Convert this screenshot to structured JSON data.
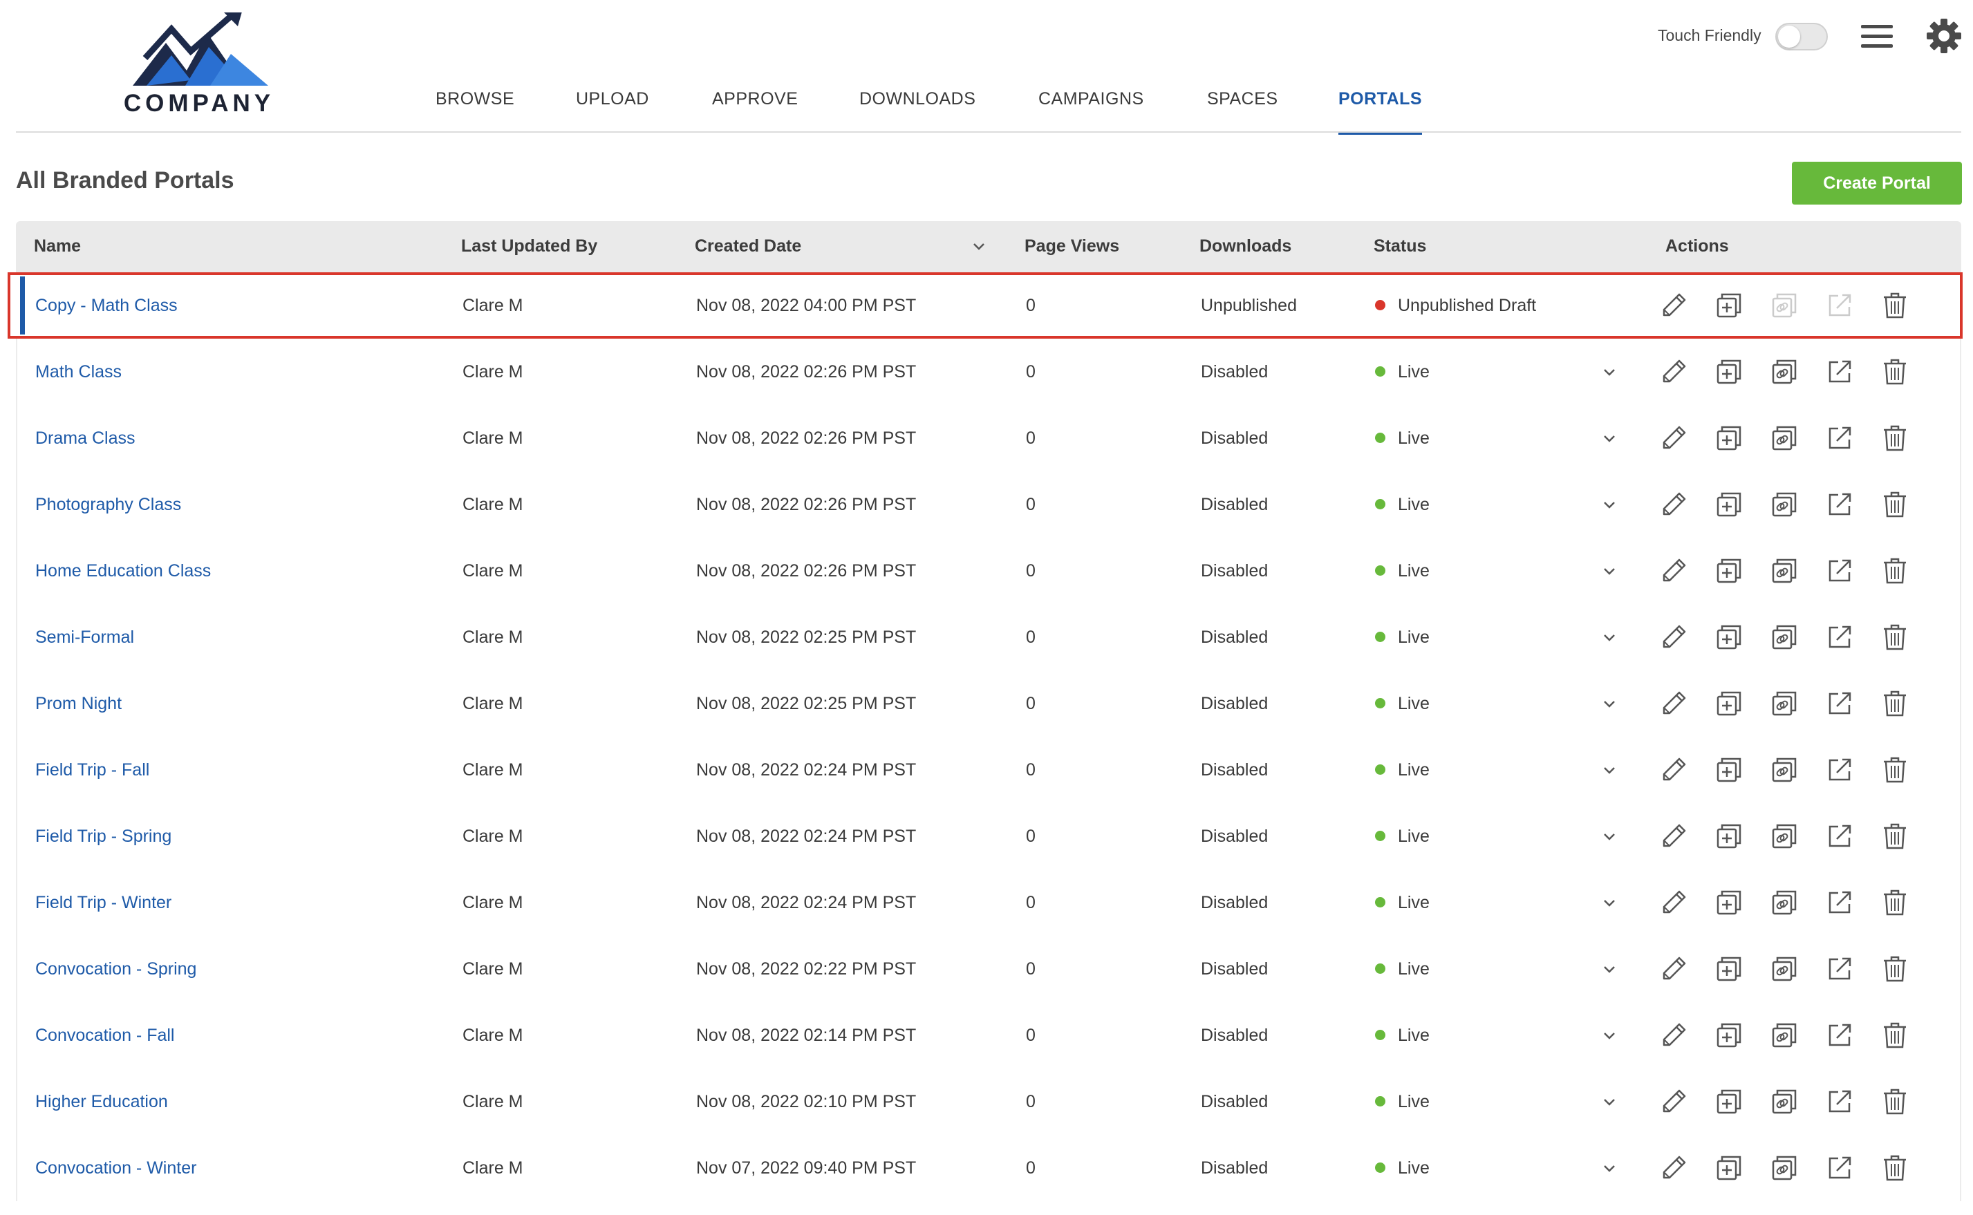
{
  "brand": {
    "logo_text": "COMPANY",
    "colors": {
      "mountain_dark": "#1d2a4a",
      "mountain_blue": "#2a6fd1"
    }
  },
  "header": {
    "nav": [
      "BROWSE",
      "UPLOAD",
      "APPROVE",
      "DOWNLOADS",
      "CAMPAIGNS",
      "SPACES",
      "PORTALS"
    ],
    "active_nav": "PORTALS",
    "touch_friendly_label": "Touch Friendly",
    "touch_friendly_on": false,
    "icons": [
      "hamburger-menu-icon",
      "gear-icon"
    ]
  },
  "page": {
    "title": "All Branded Portals",
    "create_button": "Create Portal"
  },
  "colors": {
    "accent": "#1e5aa8",
    "create_button": "#67b93b",
    "live": "#67b93b",
    "draft": "#d9362b",
    "selected_outline": "#d9362b"
  },
  "table": {
    "columns": [
      "Name",
      "Last Updated By",
      "Created Date",
      "Page Views",
      "Downloads",
      "Status",
      "Actions"
    ],
    "sorted_column": "Created Date",
    "action_icons": [
      "pencil-icon",
      "duplicate-icon",
      "copy-link-icon",
      "open-external-icon",
      "trash-icon"
    ],
    "rows": [
      {
        "name": "Copy - Math Class",
        "updated_by": "Clare M",
        "created": "Nov 08, 2022 04:00 PM PST",
        "views": "0",
        "downloads": "Unpublished",
        "status": "Unpublished Draft",
        "status_type": "draft",
        "selected": true
      },
      {
        "name": "Math Class",
        "updated_by": "Clare M",
        "created": "Nov 08, 2022 02:26 PM PST",
        "views": "0",
        "downloads": "Disabled",
        "status": "Live",
        "status_type": "live"
      },
      {
        "name": "Drama Class",
        "updated_by": "Clare M",
        "created": "Nov 08, 2022 02:26 PM PST",
        "views": "0",
        "downloads": "Disabled",
        "status": "Live",
        "status_type": "live"
      },
      {
        "name": "Photography Class",
        "updated_by": "Clare M",
        "created": "Nov 08, 2022 02:26 PM PST",
        "views": "0",
        "downloads": "Disabled",
        "status": "Live",
        "status_type": "live"
      },
      {
        "name": "Home Education Class",
        "updated_by": "Clare M",
        "created": "Nov 08, 2022 02:26 PM PST",
        "views": "0",
        "downloads": "Disabled",
        "status": "Live",
        "status_type": "live"
      },
      {
        "name": "Semi-Formal",
        "updated_by": "Clare M",
        "created": "Nov 08, 2022 02:25 PM PST",
        "views": "0",
        "downloads": "Disabled",
        "status": "Live",
        "status_type": "live"
      },
      {
        "name": "Prom Night",
        "updated_by": "Clare M",
        "created": "Nov 08, 2022 02:25 PM PST",
        "views": "0",
        "downloads": "Disabled",
        "status": "Live",
        "status_type": "live"
      },
      {
        "name": "Field Trip - Fall",
        "updated_by": "Clare M",
        "created": "Nov 08, 2022 02:24 PM PST",
        "views": "0",
        "downloads": "Disabled",
        "status": "Live",
        "status_type": "live"
      },
      {
        "name": "Field Trip - Spring",
        "updated_by": "Clare M",
        "created": "Nov 08, 2022 02:24 PM PST",
        "views": "0",
        "downloads": "Disabled",
        "status": "Live",
        "status_type": "live"
      },
      {
        "name": "Field Trip - Winter",
        "updated_by": "Clare M",
        "created": "Nov 08, 2022 02:24 PM PST",
        "views": "0",
        "downloads": "Disabled",
        "status": "Live",
        "status_type": "live"
      },
      {
        "name": "Convocation - Spring",
        "updated_by": "Clare M",
        "created": "Nov 08, 2022 02:22 PM PST",
        "views": "0",
        "downloads": "Disabled",
        "status": "Live",
        "status_type": "live"
      },
      {
        "name": "Convocation - Fall",
        "updated_by": "Clare M",
        "created": "Nov 08, 2022 02:14 PM PST",
        "views": "0",
        "downloads": "Disabled",
        "status": "Live",
        "status_type": "live"
      },
      {
        "name": "Higher Education",
        "updated_by": "Clare M",
        "created": "Nov 08, 2022 02:10 PM PST",
        "views": "0",
        "downloads": "Disabled",
        "status": "Live",
        "status_type": "live"
      },
      {
        "name": "Convocation - Winter",
        "updated_by": "Clare M",
        "created": "Nov 07, 2022 09:40 PM PST",
        "views": "0",
        "downloads": "Disabled",
        "status": "Live",
        "status_type": "live"
      }
    ]
  }
}
